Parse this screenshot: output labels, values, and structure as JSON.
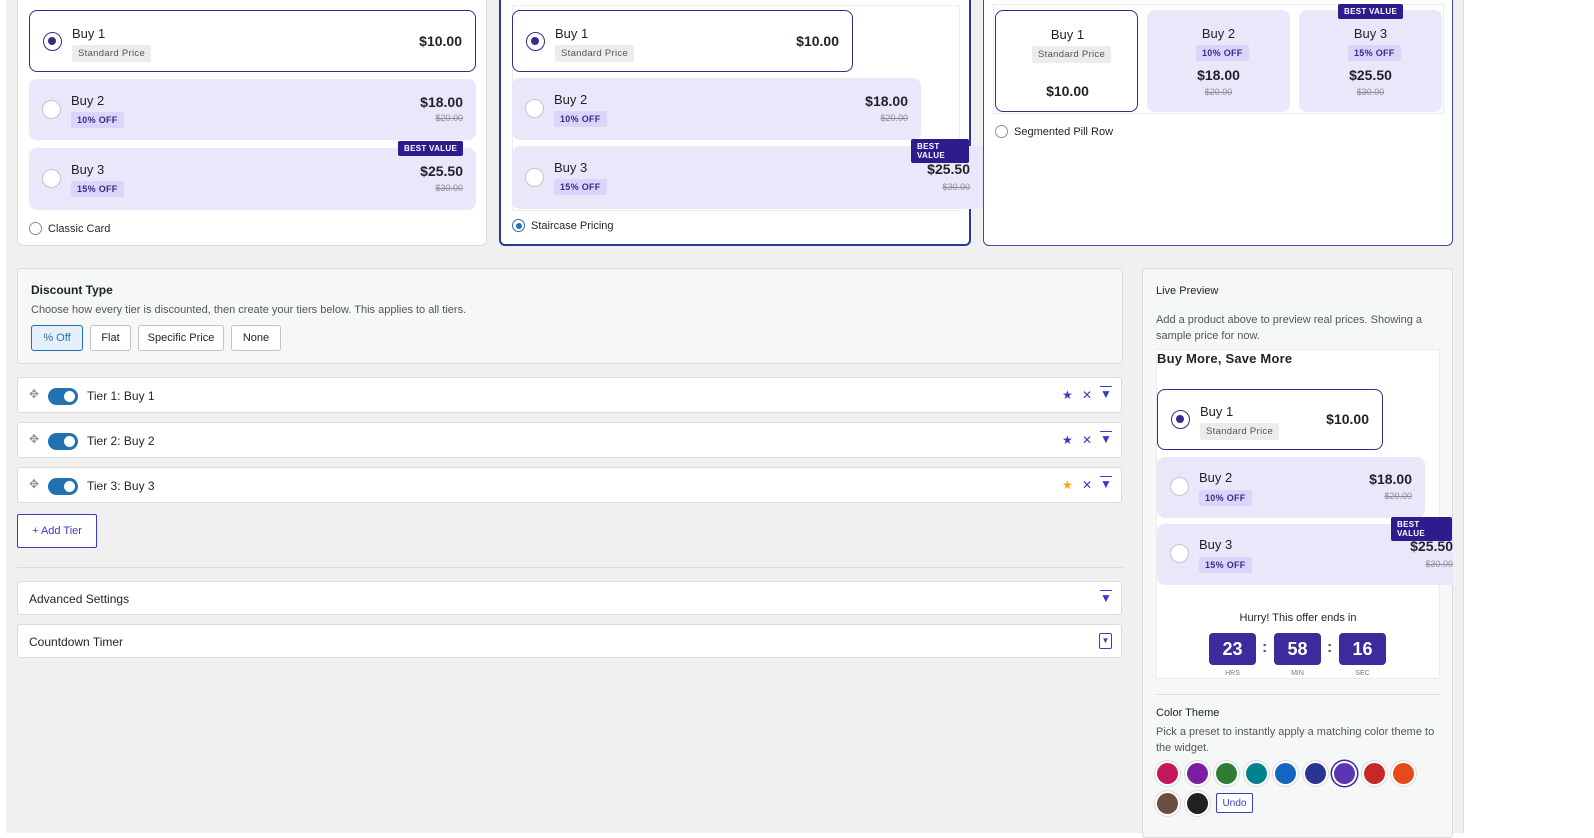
{
  "layouts": [
    {
      "label": "Classic Card",
      "selected": false
    },
    {
      "label": "Staircase Pricing",
      "selected": true
    },
    {
      "label": "Segmented Pill Row",
      "selected": false
    }
  ],
  "offers": [
    {
      "name": "Buy 1",
      "badge": "Standard Price",
      "price": "$10.00",
      "old": "",
      "best": ""
    },
    {
      "name": "Buy 2",
      "badge": "10% OFF",
      "price": "$18.00",
      "old": "$20.00",
      "best": ""
    },
    {
      "name": "Buy 3",
      "badge": "15% OFF",
      "price": "$25.50",
      "old": "$30.00",
      "best": "BEST VALUE"
    }
  ],
  "discount": {
    "title": "Discount Type",
    "help": "Choose how every tier is discounted, then create your tiers below. This applies to all tiers.",
    "options": [
      "% Off",
      "Flat",
      "Specific Price",
      "None"
    ],
    "selected": "% Off"
  },
  "tiers": [
    {
      "label": "Tier 1: Buy 1",
      "enabled": true
    },
    {
      "label": "Tier 2: Buy 2",
      "enabled": true
    },
    {
      "label": "Tier 3: Buy 3",
      "enabled": true
    }
  ],
  "add_tier_label": "+ Add Tier",
  "sections": [
    "Advanced Settings",
    "Countdown Timer"
  ],
  "preview": {
    "title": "Live Preview",
    "help": "Add a product above to preview real prices. Showing a sample price for now.",
    "widget_title": "Buy More, Save More",
    "countdown_text": "Hurry! This offer ends in",
    "hrs": "23",
    "min": "58",
    "sec": "16",
    "hrs_label": "HRS",
    "min_label": "MIN",
    "sec_label": "SEC"
  },
  "theme": {
    "title": "Color Theme",
    "help": "Pick a preset to instantly apply a matching color theme to the widget.",
    "colors": [
      "#c2185b",
      "#7b1fa2",
      "#2e7d32",
      "#00838f",
      "#1565c0",
      "#283593",
      "#5e35b1",
      "#c62828",
      "#e64a19",
      "#6d4c41",
      "#212121"
    ],
    "selected": "#5e35b1",
    "undo_label": "Undo"
  }
}
